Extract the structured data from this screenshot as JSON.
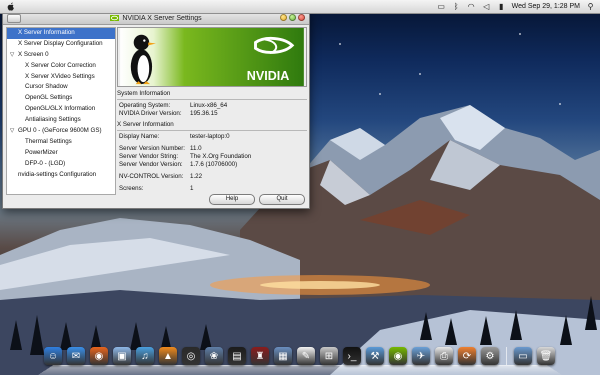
{
  "menubar": {
    "clock": "Wed Sep 29,  1:28 PM"
  },
  "window": {
    "title": "NVIDIA X Server Settings",
    "sidebar": {
      "items": [
        {
          "label": "X Server Information",
          "level": 0,
          "selected": true
        },
        {
          "label": "X Server Display Configuration",
          "level": 0
        },
        {
          "label": "X Screen 0",
          "level": 0,
          "expander": "▽"
        },
        {
          "label": "X Server Color Correction",
          "level": 1
        },
        {
          "label": "X Server XVideo Settings",
          "level": 1
        },
        {
          "label": "Cursor Shadow",
          "level": 1
        },
        {
          "label": "OpenGL Settings",
          "level": 1
        },
        {
          "label": "OpenGL/GLX Information",
          "level": 1
        },
        {
          "label": "Antialiasing Settings",
          "level": 1
        },
        {
          "label": "GPU 0 - (GeForce 9600M GS)",
          "level": 0,
          "expander": "▽"
        },
        {
          "label": "Thermal Settings",
          "level": 1
        },
        {
          "label": "PowerMizer",
          "level": 1
        },
        {
          "label": "DFP-0 - (LGD)",
          "level": 1
        },
        {
          "label": "nvidia-settings Configuration",
          "level": 0
        }
      ]
    },
    "banner": {
      "logo_text": "NVIDIA"
    },
    "system_info": {
      "title": "System Information",
      "rows": [
        {
          "key": "Operating System:",
          "value": "Linux-x86_64"
        },
        {
          "key": "NVIDIA Driver Version:",
          "value": "195.36.15"
        }
      ]
    },
    "x_server_info": {
      "title": "X Server Information",
      "display": {
        "key": "Display Name:",
        "value": "tester-laptop:0"
      },
      "rows": [
        {
          "key": "Server Version Number:",
          "value": "11.0"
        },
        {
          "key": "Server Vendor String:",
          "value": "The X.Org Foundation"
        },
        {
          "key": "Server Vendor Version:",
          "value": "1.7.6 (10706000)"
        }
      ],
      "nv_control": {
        "key": "NV-CONTROL Version:",
        "value": "1.22"
      },
      "screens": {
        "key": "Screens:",
        "value": "1"
      }
    },
    "buttons": {
      "help": "Help",
      "quit": "Quit"
    }
  },
  "dock": {
    "icons": [
      "finder-icon",
      "app-store-icon",
      "firefox-icon",
      "preview-icon",
      "itunes-icon",
      "vlc-icon",
      "photo-booth-icon",
      "iphoto-icon",
      "terminal-icon",
      "wine-icon",
      "preview2-icon",
      "textedit-icon",
      "calculator-icon",
      "terminal2-icon",
      "xcode-icon",
      "nvidia-icon",
      "mail-icon",
      "printer-icon",
      "sync-icon",
      "system-prefs-icon",
      "folder-icon",
      "trash-icon"
    ]
  },
  "colors": {
    "selection": "#3d72c9",
    "nvidia_green": "#76b900"
  }
}
